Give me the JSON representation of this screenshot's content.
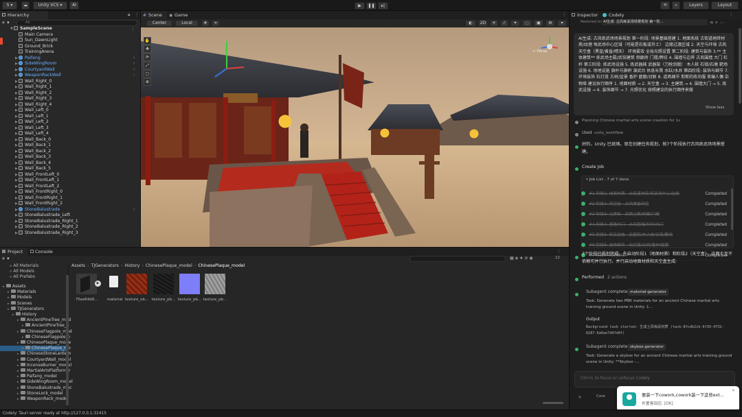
{
  "topbar": {
    "account_label": "S ▾",
    "vcs_label": "Unity VCS ▾",
    "ai_label": "AI",
    "layers_label": "Layers",
    "layout_label": "Layout"
  },
  "hierarchy": {
    "tab_label": "Hierarchy",
    "search_placeholder": "All",
    "scene_name": "SampleScene",
    "items": [
      {
        "label": "Main Camera",
        "prefab": false,
        "expandable": false
      },
      {
        "label": "Sun_DawnLight",
        "prefab": false,
        "expandable": false
      },
      {
        "label": "Ground_Brick",
        "prefab": false,
        "expandable": false
      },
      {
        "label": "TrainingArena",
        "prefab": false,
        "expandable": false
      },
      {
        "label": "Paifang",
        "prefab": true,
        "expandable": true
      },
      {
        "label": "SideWingRoom",
        "prefab": true,
        "expandable": true
      },
      {
        "label": "CourtyardWall",
        "prefab": true,
        "expandable": true
      },
      {
        "label": "WeaponRackWall",
        "prefab": true,
        "expandable": true
      },
      {
        "label": "Wall_Right_0",
        "prefab": false,
        "expandable": true
      },
      {
        "label": "Wall_Right_1",
        "prefab": false,
        "expandable": true
      },
      {
        "label": "Wall_Right_2",
        "prefab": false,
        "expandable": true
      },
      {
        "label": "Wall_Right_3",
        "prefab": false,
        "expandable": true
      },
      {
        "label": "Wall_Right_4",
        "prefab": false,
        "expandable": true
      },
      {
        "label": "Wall_Left_0",
        "prefab": false,
        "expandable": true
      },
      {
        "label": "Wall_Left_1",
        "prefab": false,
        "expandable": true
      },
      {
        "label": "Wall_Left_2",
        "prefab": false,
        "expandable": true
      },
      {
        "label": "Wall_Left_3",
        "prefab": false,
        "expandable": true
      },
      {
        "label": "Wall_Left_4",
        "prefab": false,
        "expandable": true
      },
      {
        "label": "Wall_Back_0",
        "prefab": false,
        "expandable": true
      },
      {
        "label": "Wall_Back_1",
        "prefab": false,
        "expandable": true
      },
      {
        "label": "Wall_Back_2",
        "prefab": false,
        "expandable": true
      },
      {
        "label": "Wall_Back_3",
        "prefab": false,
        "expandable": true
      },
      {
        "label": "Wall_Back_4",
        "prefab": false,
        "expandable": true
      },
      {
        "label": "Wall_Back_5",
        "prefab": false,
        "expandable": true
      },
      {
        "label": "Wall_FrontLeft_0",
        "prefab": false,
        "expandable": true
      },
      {
        "label": "Wall_FrontLeft_1",
        "prefab": false,
        "expandable": true
      },
      {
        "label": "Wall_FrontLeft_2",
        "prefab": false,
        "expandable": true
      },
      {
        "label": "Wall_FrontRight_0",
        "prefab": false,
        "expandable": true
      },
      {
        "label": "Wall_FrontRight_1",
        "prefab": false,
        "expandable": true
      },
      {
        "label": "Wall_FrontRight_2",
        "prefab": false,
        "expandable": true
      },
      {
        "label": "StoneBalustrade",
        "prefab": true,
        "expandable": true
      },
      {
        "label": "StoneBalustrade_Left",
        "prefab": false,
        "expandable": true
      },
      {
        "label": "StoneBalustrade_Right_1",
        "prefab": false,
        "expandable": true
      },
      {
        "label": "StoneBalustrade_Right_2",
        "prefab": false,
        "expandable": true
      },
      {
        "label": "StoneBalustrade_Right_3",
        "prefab": false,
        "expandable": true
      }
    ]
  },
  "scene": {
    "tab_scene": "Scene",
    "tab_game": "Game",
    "pivot_label": "Center",
    "space_label": "Local",
    "mode_2d": "2D",
    "persp_label": "< Persp"
  },
  "project": {
    "tab_project": "Project",
    "tab_console": "Console",
    "count_label": "22",
    "favorites": [
      "All Materials",
      "All Models",
      "All Prefabs"
    ],
    "breadcrumb": [
      "Assets",
      "TJGenerators",
      "History",
      "ChinesePlaque_model",
      "ChinesePlaque_model"
    ],
    "tree": [
      {
        "label": "Assets",
        "depth": 0,
        "selected": false
      },
      {
        "label": "Materials",
        "depth": 1,
        "selected": false
      },
      {
        "label": "Models",
        "depth": 1,
        "selected": false
      },
      {
        "label": "Scenes",
        "depth": 1,
        "selected": false
      },
      {
        "label": "TJGenerators",
        "depth": 1,
        "selected": false
      },
      {
        "label": "History",
        "depth": 2,
        "selected": false
      },
      {
        "label": "AncientPineTree_mod",
        "depth": 3,
        "selected": false
      },
      {
        "label": "AncientPineTree_n",
        "depth": 4,
        "selected": false
      },
      {
        "label": "ChineseFlagpole_mod",
        "depth": 3,
        "selected": false
      },
      {
        "label": "ChineseFlagpole_n",
        "depth": 4,
        "selected": false
      },
      {
        "label": "ChinesePlaque_mode",
        "depth": 3,
        "selected": false
      },
      {
        "label": "ChinesePlaque_mo",
        "depth": 4,
        "selected": true
      },
      {
        "label": "ChineseStoneLantern",
        "depth": 3,
        "selected": false
      },
      {
        "label": "CourtyardWall_model",
        "depth": 3,
        "selected": false
      },
      {
        "label": "IncenseBurner_model",
        "depth": 3,
        "selected": false
      },
      {
        "label": "MartialArtsPlatform_r",
        "depth": 3,
        "selected": false
      },
      {
        "label": "Paifang_model",
        "depth": 3,
        "selected": false
      },
      {
        "label": "SideWingRoom_model",
        "depth": 3,
        "selected": false
      },
      {
        "label": "StoneBalustrade_moc",
        "depth": 3,
        "selected": false
      },
      {
        "label": "StoneLock_model",
        "depth": 3,
        "selected": false
      },
      {
        "label": "WeaponRack_model",
        "depth": 3,
        "selected": false
      }
    ],
    "assets": [
      {
        "label": "75ee64d8...",
        "kind": "model"
      },
      {
        "label": "material",
        "kind": "file"
      },
      {
        "label": "texture_ob...",
        "kind": "tex-red"
      },
      {
        "label": "texture_pb...",
        "kind": "tex-dark"
      },
      {
        "label": "texture_pb...",
        "kind": "tex-normal"
      },
      {
        "label": "texture_pb...",
        "kind": "tex-gray"
      }
    ]
  },
  "inspector": {
    "tab_inspector": "Inspector",
    "tab_codely": "Codely",
    "restored_label": "Restored to:",
    "session_title": "AI生成: 古风练武场场景规划 第一阶...",
    "user_message": "AI生成: 古风练武场场景规划 第一阶段: 场景基础搭建 1. 地面系统 古街道地砖材质/纹理 每武场中心区域（可能是石板或夯土） 边缘过渡区域 2. 天空与环境 古风天空盒（黑蓝/黄昏/晴天） 环境雾效 全局光照设置 第二阶段: 建筑与装饰 3.** 主体建筑** 练武场主殿/武馆建筑 侧廊房 门楼/牌坊 4. 围墙与边界 古风围墙 大门 栏杆 第三阶段: 练武场设施 5. 练武器械 武器架（刀枪剑戟） 木人桩 石锁/石墩 靶场设施 6. 场地设施 旗杆与旗帜 演武台 休息长凳 水缸/水井 第四阶段: 装饰与细节 7. 环境装饰 石灯笼 古树/盆景 香炉 匾额/对联 8. 道具细节 剪断的练功服 草编人偶 杂物堆 建议执行顺序 1. 地面材质 → 2. 天空盒 → 3. 主建筑 → 4. 围墙大门 → 5. 练武设施 → 6. 装饰细节 → 7. 光照优化 按照建议的执行顺序来做",
    "show_less": "Show less",
    "planning_label": "Planning Chinese martial arts scene creation for 1s",
    "used_label": "Used",
    "used_tool": "unity_workflow",
    "reply_1": "好的，Unity 已就绪。现在创建任务规划，按7个阶段执行古风练武场场景搭建。",
    "create_job": "Create Job",
    "job_list_label": "Job List - 7 of 7 done",
    "jobs": [
      {
        "label": "#1 阶段1: 地面材质 - 古街道地砖/练武场中心/边缘",
        "status": "Completed"
      },
      {
        "label": "#2 阶段2: 天空盒 - 古风黄昏天空",
        "status": "Completed"
      },
      {
        "label": "#3 阶段3: 主建筑 - 武馆主殿/侧廊/门楼",
        "status": "Completed"
      },
      {
        "label": "#4 阶段4: 围墙大门 - 古风围墙/栏杆/大门",
        "status": "Completed"
      },
      {
        "label": "#5 阶段5: 练武设施 - 武器架/木人桩/石锁/靶场",
        "status": "Completed"
      },
      {
        "label": "#6 阶段6: 装饰细节 - 石灯笼/古树/香炉/匾额",
        "status": "Completed"
      },
      {
        "label": "#7 阶段7: 光照优化",
        "status": "Completed"
      }
    ],
    "reply_2": "7个阶段已规划完成。先启动阶段1（地面材质）和阶段2（天空盒），这两个互不依赖可并行执行。并行启动地面材质和天空盒生成:",
    "performed_label": "Performed",
    "performed_count": "2 actions",
    "sub1_label": "Subagent completed",
    "sub1_tool": "material-generator",
    "sub1_task": "Task: Generate two PBR materials for an ancient Chinese martial arts training ground scene in Unity: 1...",
    "output_label": "Output",
    "output_text": "Background task started: 生成土风练武材质 (task-8fcdb2cb-6f39-4732-8287-6a6ae7d0fd0f)",
    "sub2_label": "Subagent completed",
    "sub2_tool": "skybox-generator",
    "sub2_task": "Task: Generate a skybox for an ancient Chinese martial arts training ground scene in Unity: **Skybox -...",
    "input_placeholder": "Ctrl+L to focus or unfocus Codely",
    "mode_label": "Core"
  },
  "toast": {
    "title": "要装一下cowork,cowork装一下这些ext...",
    "subtitle": "外置客回应: [OK]"
  },
  "status": {
    "text": "Codely: Tauri server ready at http://127.0.0.1:31415"
  }
}
